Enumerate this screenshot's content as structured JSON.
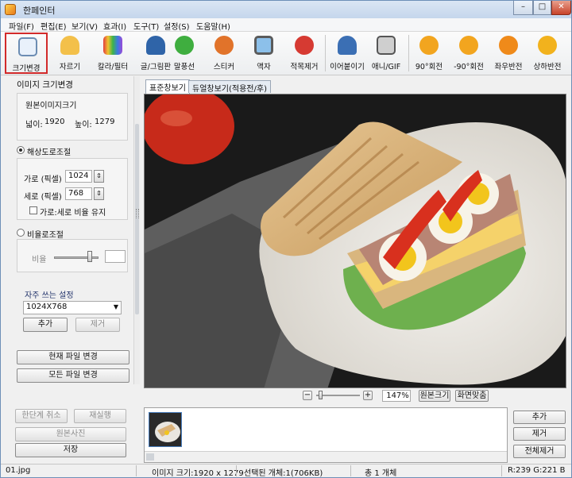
{
  "window": {
    "title": "한페인터",
    "minimize": "–",
    "maximize": "□",
    "close": "✕"
  },
  "menu": [
    "파일(F)",
    "편집(E)",
    "보기(V)",
    "효과(I)",
    "도구(T)",
    "설정(S)",
    "도움말(H)"
  ],
  "toolbar": [
    {
      "label": "크기변경",
      "icon": "resize-icon",
      "color": "#3c7fc7"
    },
    {
      "label": "자르기",
      "icon": "crop-icon",
      "color": "#e0a92c"
    },
    {
      "label": "칼라/필터",
      "icon": "color-filter-icon",
      "color": "#7a4fc4"
    },
    {
      "label": "글/그림판",
      "icon": "text-drawing-icon",
      "color": "#d3342a"
    },
    {
      "label": "말풍선",
      "icon": "speech-bubble-icon",
      "color": "#39a83b"
    },
    {
      "label": "스티커",
      "icon": "sticker-icon",
      "color": "#e56b20"
    },
    {
      "label": "액자",
      "icon": "frame-icon",
      "color": "#4a90d6"
    },
    {
      "label": "적목제거",
      "icon": "red-eye-icon",
      "color": "#c9302c"
    },
    {
      "label": "이어붙이기",
      "icon": "merge-icon",
      "color": "#3a6fb3"
    },
    {
      "label": "애니/GIF",
      "icon": "gif-icon",
      "color": "#d8d8d8"
    },
    {
      "label": "90°회전",
      "icon": "rotate-cw-icon",
      "color": "#f0a21c"
    },
    {
      "label": "-90°회전",
      "icon": "rotate-ccw-icon",
      "color": "#f0a21c"
    },
    {
      "label": "좌우반전",
      "icon": "flip-horizontal-icon",
      "color": "#ef8a1a"
    },
    {
      "label": "상하반전",
      "icon": "flip-vertical-icon",
      "color": "#f2b21d"
    }
  ],
  "resize_panel": {
    "heading": "이미지 크기변경",
    "original_label": "원본이미지크기",
    "width_label": "넓이:",
    "width_value": "1920",
    "height_label": "높이:",
    "height_value": "1279",
    "resolution_option": "해상도로조절",
    "px_width_label": "가로 (픽셀)",
    "px_width_value": "1024",
    "px_height_label": "세로 (픽셀)",
    "px_height_value": "768",
    "keep_ratio_label": "가로:세로 비율 유지",
    "ratio_option": "비율로조절",
    "ratio_label": "비율",
    "ratio_slider_level": 0.8,
    "ratio_value": "",
    "presets_heading": "자주 쓰는 설정",
    "preset_selected": "1024X768",
    "add_label": "추가",
    "remove_label": "제거",
    "apply_current": "현재 파일 변경",
    "apply_all": "모든 파일 변경"
  },
  "tabs": [
    "표준창보기",
    "듀얼창보기(적용전/후)"
  ],
  "zoom": {
    "minus": "−",
    "plus": "+",
    "value": "147%",
    "original": "원본크기",
    "fit": "화면맞춤",
    "slider_level": 0.05
  },
  "history": {
    "undo": "한단계 취소",
    "redo": "재실행",
    "original": "원본사진",
    "save": "저장"
  },
  "thumb_panel": {
    "add": "추가",
    "remove": "제거",
    "remove_all": "전체제거"
  },
  "status": {
    "file": "01.jpg",
    "size": "이미지 크기:1920 x 1279",
    "selected": "선택된 개체:1(706KB)",
    "total": "총 1 개체",
    "rgb": "R:239 G:221 B"
  },
  "colors": {
    "accent_red": "#d22a2a",
    "titlebar": "#c5d6ec"
  }
}
